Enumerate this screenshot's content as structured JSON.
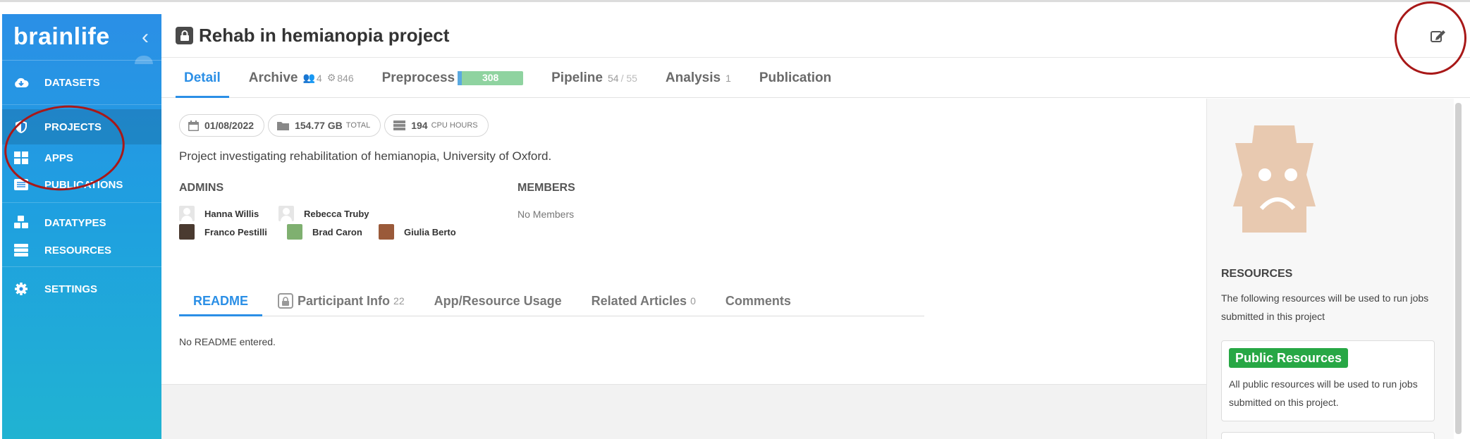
{
  "app": {
    "brand": "brainlife",
    "collapse_icon": "chevron-left-icon"
  },
  "sidebar": {
    "items": [
      {
        "label": "DATASETS",
        "icon": "cloud-download-icon"
      },
      {
        "label": "PROJECTS",
        "icon": "shield-icon",
        "active": true
      },
      {
        "label": "APPS",
        "icon": "grid-icon"
      },
      {
        "label": "PUBLICATIONS",
        "icon": "list-icon"
      },
      {
        "label": "DATATYPES",
        "icon": "cubes-icon"
      },
      {
        "label": "RESOURCES",
        "icon": "server-icon"
      },
      {
        "label": "SETTINGS",
        "icon": "gear-icon"
      }
    ]
  },
  "header": {
    "title": "Rehab in hemianopia project",
    "lock_icon": "lock-icon",
    "edit_icon": "edit-icon"
  },
  "tabs": [
    {
      "label": "Detail",
      "active": true
    },
    {
      "label": "Archive",
      "sub1": "4",
      "sub2": "846"
    },
    {
      "label": "Preprocess",
      "progress_value": "308"
    },
    {
      "label": "Pipeline",
      "sub": "54",
      "sub_total": "/ 55"
    },
    {
      "label": "Analysis",
      "sub": "1"
    },
    {
      "label": "Publication"
    }
  ],
  "detail": {
    "date": "01/08/2022",
    "storage": "154.77 GB",
    "storage_unit": "TOTAL",
    "cpu": "194",
    "cpu_unit": "CPU HOURS",
    "description": "Project investigating rehabilitation of hemianopia, University of Oxford.",
    "admins_label": "ADMINS",
    "admins": [
      "Hanna Willis",
      "Rebecca Truby",
      "Franco Pestilli",
      "Brad Caron",
      "Giulia Berto"
    ],
    "members_label": "MEMBERS",
    "members_empty": "No Members"
  },
  "subtabs": [
    {
      "label": "README",
      "active": true
    },
    {
      "label": "Participant Info",
      "count": "22"
    },
    {
      "label": "App/Resource Usage"
    },
    {
      "label": "Related Articles",
      "count": "0"
    },
    {
      "label": "Comments"
    }
  ],
  "readme": {
    "empty_text": "No README entered."
  },
  "resources_panel": {
    "title": "RESOURCES",
    "text": "The following resources will be used to run jobs submitted in this project",
    "card": {
      "name": "Public Resources",
      "desc": "All public resources will be used to run jobs submitted on this project."
    }
  },
  "colors": {
    "accent": "#2b8fe6",
    "sidebar": "#1f9fe0",
    "resource_green": "#27a745",
    "annotation": "#a81818"
  }
}
